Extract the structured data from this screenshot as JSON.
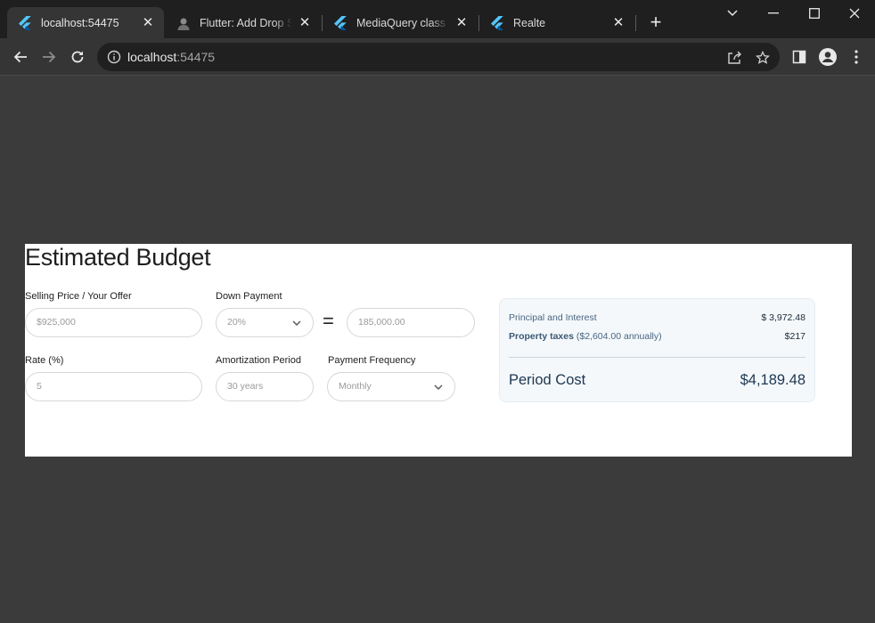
{
  "browser": {
    "tabs": [
      {
        "title": "localhost:54475",
        "favicon": "flutter-icon",
        "active": true
      },
      {
        "title": "Flutter: Add Drop Shadow",
        "favicon": "avatar-icon",
        "active": false
      },
      {
        "title": "MediaQuery class - widgets",
        "favicon": "flutter-icon",
        "active": false
      },
      {
        "title": "Realte",
        "favicon": "flutter-icon",
        "active": false
      }
    ],
    "address": {
      "host": "localhost",
      "port": ":54475"
    }
  },
  "budget": {
    "title": "Estimated Budget",
    "selling_price": {
      "label": "Selling Price / Your Offer",
      "value": "$925,000"
    },
    "down_payment": {
      "label": "Down Payment",
      "percent": "20%",
      "amount": "185,000.00"
    },
    "equals": "=",
    "rate": {
      "label": "Rate (%)",
      "value": "5"
    },
    "amortization": {
      "label": "Amortization Period",
      "value": "30 years"
    },
    "frequency": {
      "label": "Payment Frequency",
      "value": "Monthly"
    }
  },
  "summary": {
    "principal_label": "Principal and Interest",
    "principal_value": "$ 3,972.48",
    "taxes_label": "Property taxes",
    "taxes_note": "($2,604.00 annually)",
    "taxes_value": "$217",
    "period_label": "Period Cost",
    "period_value": "$4,189.48"
  },
  "colors": {
    "accent": "#1d3650",
    "background": "#3b3b3b",
    "card": "#ffffff"
  }
}
